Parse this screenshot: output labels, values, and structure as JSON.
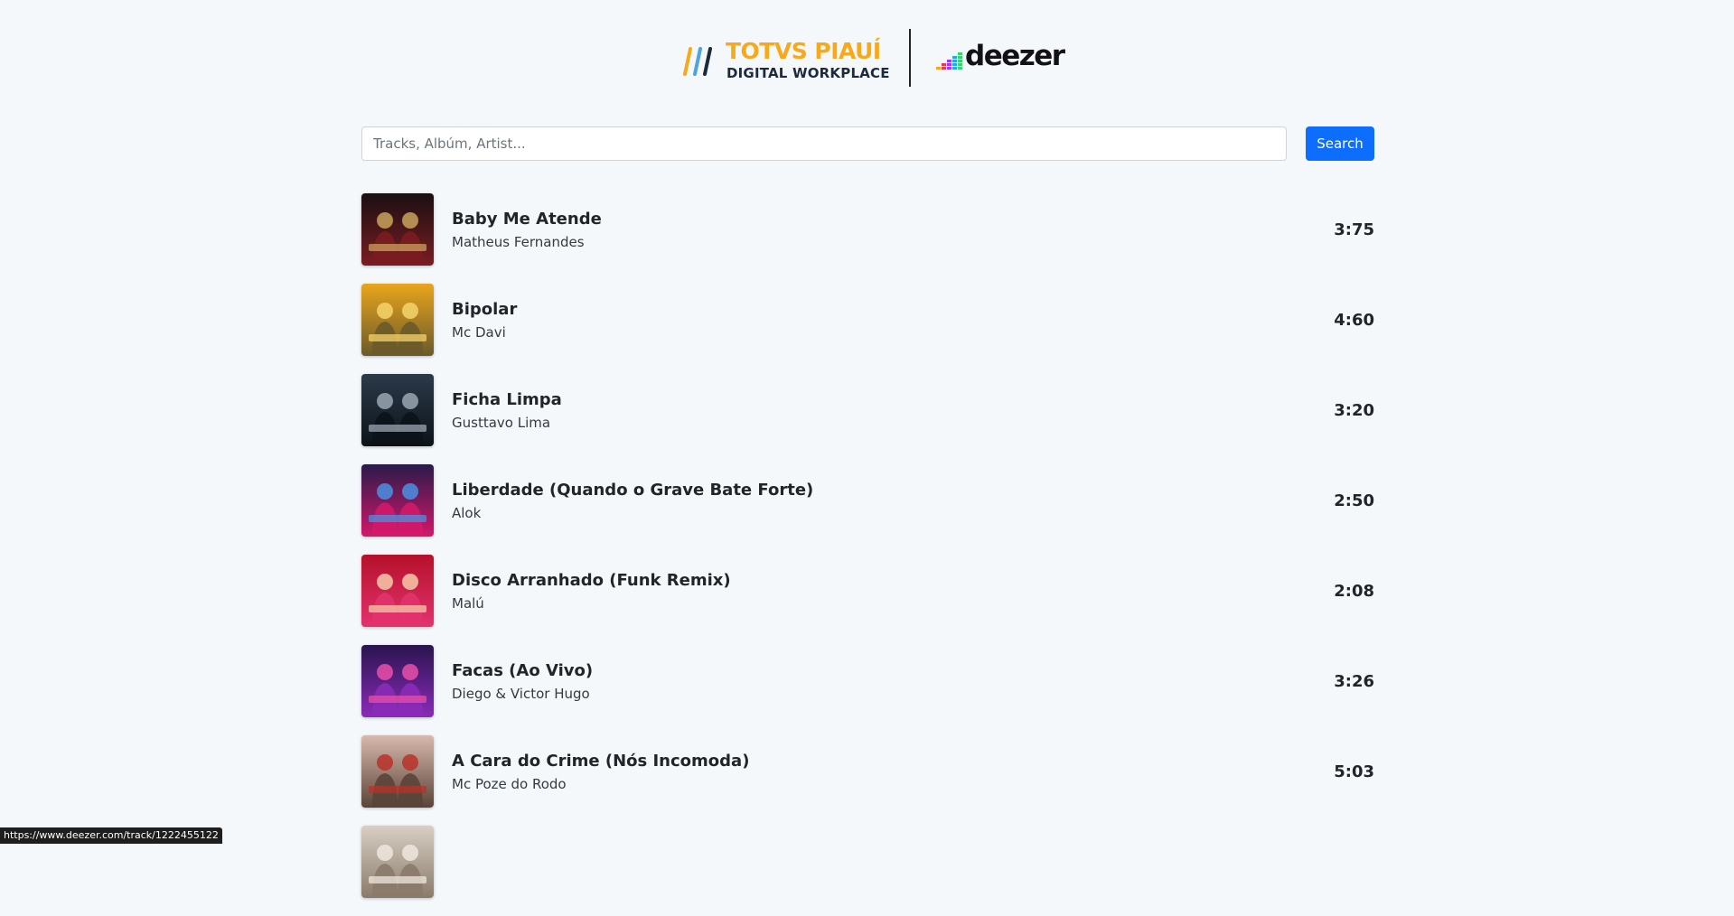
{
  "header": {
    "brand_title": "TOTVS PIAUÍ",
    "brand_subtitle": "DIGITAL WORKPLACE",
    "partner_name": "deezer"
  },
  "search": {
    "placeholder": "Tracks, Albúm, Artist...",
    "value": "",
    "button_label": "Search"
  },
  "tracks": [
    {
      "title": "Baby Me Atende",
      "artist": "Matheus Fernandes",
      "duration": "3:75",
      "cover_colors": [
        "#1a0f12",
        "#7a1d22",
        "#c9a25b"
      ]
    },
    {
      "title": "Bipolar",
      "artist": "Mc Davi",
      "duration": "4:60",
      "cover_colors": [
        "#e8a51c",
        "#6b5a2a",
        "#f5d36b"
      ]
    },
    {
      "title": "Ficha Limpa",
      "artist": "Gusttavo Lima",
      "duration": "3:20",
      "cover_colors": [
        "#2b3a4a",
        "#0c1218",
        "#9aa7b3"
      ]
    },
    {
      "title": "Liberdade (Quando o Grave Bate Forte)",
      "artist": "Alok",
      "duration": "2:50",
      "cover_colors": [
        "#2a1a4a",
        "#d2186a",
        "#4a90e2"
      ]
    },
    {
      "title": "Disco Arranhado (Funk Remix)",
      "artist": "Malú",
      "duration": "2:08",
      "cover_colors": [
        "#b5102a",
        "#e2336e",
        "#f7c9a8"
      ]
    },
    {
      "title": "Facas (Ao Vivo)",
      "artist": "Diego & Victor Hugo",
      "duration": "3:26",
      "cover_colors": [
        "#2a1450",
        "#8a2bb8",
        "#e84fa8"
      ]
    },
    {
      "title": "A Cara do Crime (Nós Incomoda)",
      "artist": "Mc Poze do Rodo",
      "duration": "5:03",
      "cover_colors": [
        "#d9b9ad",
        "#5a4438",
        "#b8322a"
      ]
    },
    {
      "title": "",
      "artist": "",
      "duration": "",
      "cover_colors": [
        "#d8cfc4",
        "#8a7a6a",
        "#efe8df"
      ]
    }
  ],
  "status_bar": {
    "url": "https://www.deezer.com/track/1222455122"
  },
  "colors": {
    "background": "#f4f8fb",
    "accent": "#0d6efd",
    "brand_yellow": "#f6a91b"
  }
}
